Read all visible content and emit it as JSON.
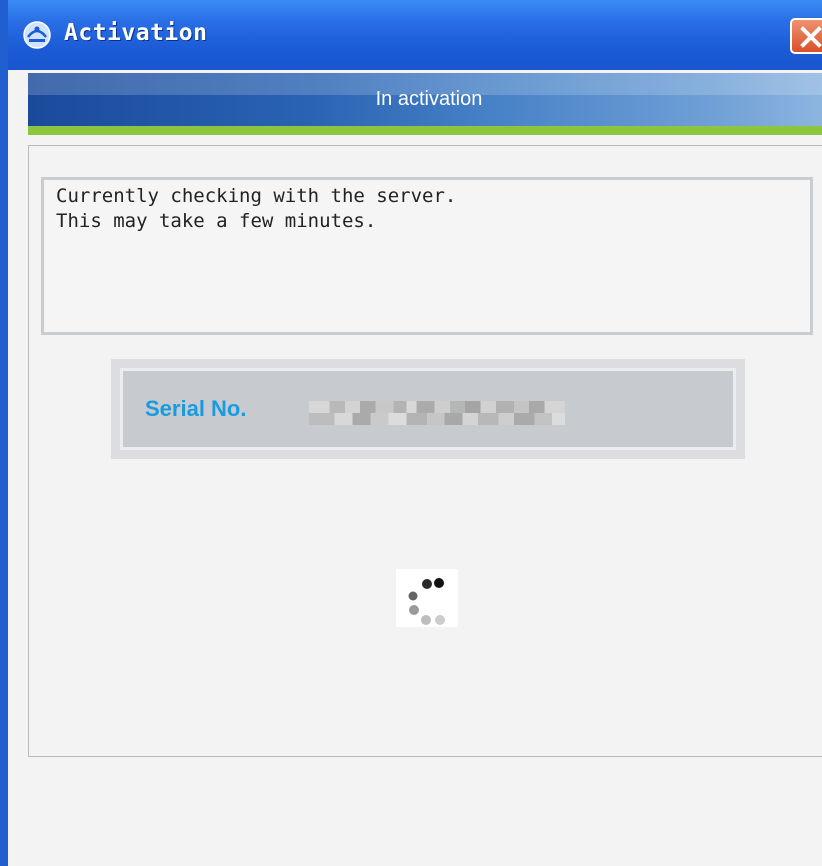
{
  "window": {
    "title": "Activation",
    "close_icon": "close-icon",
    "app_icon": "app-logo-icon"
  },
  "header": {
    "status_title": "In activation"
  },
  "message": {
    "line1": "Currently checking with the server.",
    "line2": "This may take a few minutes."
  },
  "serial": {
    "label": "Serial No.",
    "value_redacted": true
  },
  "spinner": {
    "icon": "loading-spinner-icon"
  },
  "colors": {
    "titlebar": "#2a6ee6",
    "close_button": "#d9502a",
    "header_band": "#2a63b3",
    "accent_green": "#8cc63f",
    "serial_label": "#1a9be0"
  }
}
